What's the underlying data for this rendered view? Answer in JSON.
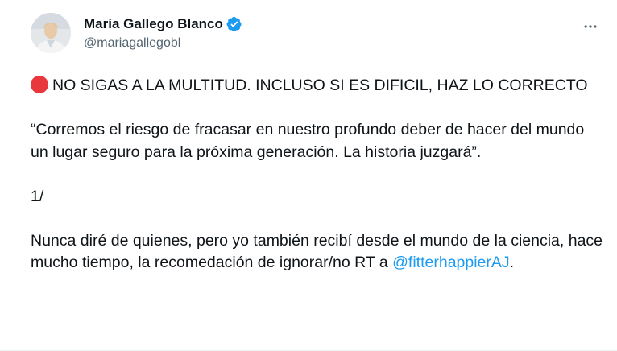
{
  "author": {
    "display_name": "María Gallego Blanco",
    "handle": "@mariagallegobl",
    "verified": true,
    "avatar_icon": "profile-photo",
    "verified_icon": "verified-badge-icon",
    "more_icon": "more-options-icon"
  },
  "tweet": {
    "p1_emoji_icon": "red-circle-emoji",
    "p1_text": "NO SIGAS A LA MULTITUD. INCLUSO SI ES DIFICIL, HAZ LO CORRECTO",
    "p2_text": "“Corremos el riesgo de fracasar en nuestro profundo deber de hacer del mundo un lugar seguro para la próxima generación. La historia juzgará”.",
    "p3_text": "1/",
    "p4_text": "Nunca diré de quienes, pero yo también recibí desde el mundo de la ciencia, hace mucho tiempo, la recomedación de ignorar/no RT a",
    "p4_mention": "@fitterhappierAJ",
    "p4_end": "."
  },
  "colors": {
    "text": "#0f1419",
    "secondary": "#536471",
    "link": "#1d9bf0",
    "verified": "#1d9bf0",
    "red_circle": "#e8383d"
  }
}
